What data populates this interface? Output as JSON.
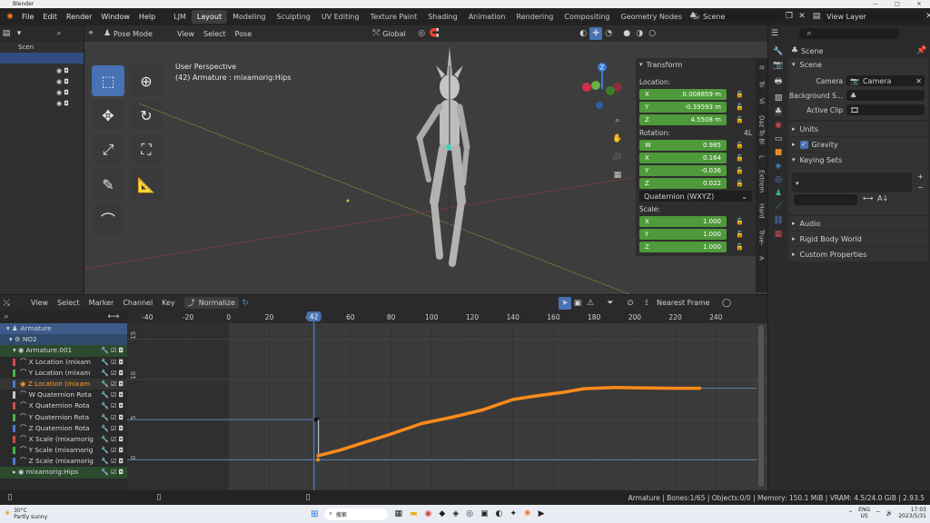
{
  "window": {
    "title": "Blender",
    "controls": [
      "—",
      "□",
      "✕"
    ]
  },
  "topbar": {
    "menu": [
      "File",
      "Edit",
      "Render",
      "Window",
      "Help"
    ],
    "tabs": [
      "LJM",
      "Layout",
      "Modeling",
      "Sculpting",
      "UV Editing",
      "Texture Paint",
      "Shading",
      "Animation",
      "Rendering",
      "Compositing",
      "Geometry Nodes",
      "Scripti"
    ],
    "active_tab": "Layout",
    "scene": "Scene",
    "view_layer": "View Layer"
  },
  "outliner": {
    "header": "Scen"
  },
  "viewport": {
    "mode": "Pose Mode",
    "menus": [
      "View",
      "Select",
      "Pose"
    ],
    "orientation": "Global",
    "pose_options": "Pose Options",
    "perspective": "User Perspective",
    "object_info": "(42) Armature : mixamorig:Hips",
    "side_tabs": [
      "It",
      "To",
      "Vi",
      "Daz To Bl",
      "L",
      "Extrem",
      "Hard",
      "True-",
      "A"
    ]
  },
  "transform": {
    "title": "Transform",
    "location_label": "Location:",
    "location": [
      {
        "axis": "X",
        "value": "0.008859 m"
      },
      {
        "axis": "Y",
        "value": "-0.39593 m"
      },
      {
        "axis": "Z",
        "value": "4.5508 m"
      }
    ],
    "rotation_label": "Rotation:",
    "rotation_mode_badge": "4L",
    "rotation": [
      {
        "axis": "W",
        "value": "0.985"
      },
      {
        "axis": "X",
        "value": "0.164"
      },
      {
        "axis": "Y",
        "value": "-0.036"
      },
      {
        "axis": "Z",
        "value": "0.022"
      }
    ],
    "rotation_mode": "Quaternion (WXYZ)",
    "scale_label": "Scale:",
    "scale": [
      {
        "axis": "X",
        "value": "1.000"
      },
      {
        "axis": "Y",
        "value": "1.000"
      },
      {
        "axis": "Z",
        "value": "1.000"
      }
    ]
  },
  "properties": {
    "header_scene": "Scene",
    "section_scene": "Scene",
    "camera_label": "Camera",
    "camera_value": "Camera",
    "background_label": "Background S...",
    "active_clip_label": "Active Clip",
    "units": "Units",
    "gravity": "Gravity",
    "keying_sets": "Keying Sets",
    "audio": "Audio",
    "rigid_body": "Rigid Body World",
    "custom_props": "Custom Properties"
  },
  "graph": {
    "menus": [
      "View",
      "Select",
      "Marker",
      "Channel",
      "Key"
    ],
    "normalize": "Normalize",
    "snapping": "Nearest Frame",
    "current_frame": "42",
    "frame_ticks": [
      "-40",
      "-20",
      "0",
      "20",
      "40",
      "60",
      "80",
      "100",
      "120",
      "140",
      "160",
      "180",
      "200",
      "220",
      "240"
    ],
    "value_ticks": [
      "15",
      "10",
      "5",
      "0"
    ],
    "channels": {
      "armature": "Armature",
      "action": "NO2",
      "armature_data": "Armature.001",
      "curves": [
        "X Location (mixam",
        "Y Location (mixam",
        "Z Location (mixam",
        "W Quaternion Rota",
        "X Quaternion Rota",
        "Y Quaternion Rota",
        "Z Quaternion Rota",
        "X Scale (mixamorig",
        "Y Scale (mixamorig",
        "Z Scale (mixamorig"
      ],
      "hips": "mixamorig:Hips"
    }
  },
  "status": {
    "text": "Armature | Bones:1/65 | Objects:0/0 | Memory: 150.1 MiB | VRAM: 4.5/24.0 GiB | 2.93.5"
  },
  "taskbar": {
    "weather_temp": "30°C",
    "weather_desc": "Partly sunny",
    "search": "搜索",
    "lang1": "ENG",
    "lang2": "US",
    "time": "17:03",
    "date": "2023/5/31"
  },
  "colors": {
    "accent": "#4772b3",
    "curve": "#ff8c1a",
    "green_field": "#4f9a3a",
    "frame_line": "#4772b3"
  }
}
